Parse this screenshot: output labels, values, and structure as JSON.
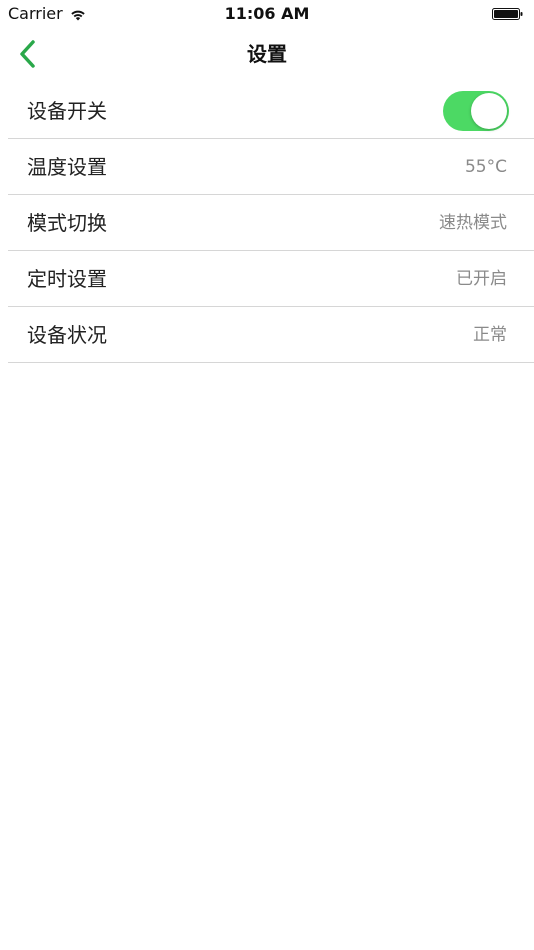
{
  "status_bar": {
    "carrier": "Carrier",
    "time": "11:06 AM",
    "icons": [
      "wifi-icon",
      "battery-icon"
    ]
  },
  "nav": {
    "title": "设置",
    "back_icon": "chevron-left-icon",
    "accent_color": "#2aa84a"
  },
  "settings": {
    "device_switch": {
      "label": "设备开关",
      "toggle_on": true,
      "toggle_color": "#4cd964"
    },
    "temperature": {
      "label": "温度设置",
      "value": "55°C"
    },
    "mode": {
      "label": "模式切换",
      "value": "速热模式"
    },
    "timer": {
      "label": "定时设置",
      "value": "已开启"
    },
    "status": {
      "label": "设备状况",
      "value": "正常"
    }
  }
}
